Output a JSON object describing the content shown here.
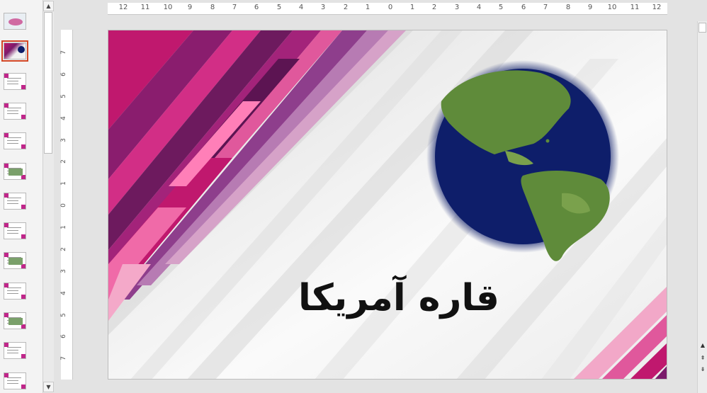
{
  "thumbnail_panel": {
    "selected_index": 1,
    "thumbs": [
      "slide-1",
      "slide-2",
      "slide-3",
      "slide-4",
      "slide-5",
      "slide-6",
      "slide-7",
      "slide-8",
      "slide-9",
      "slide-10",
      "slide-11",
      "slide-12",
      "slide-13"
    ]
  },
  "horizontal_ruler": {
    "labels": [
      "12",
      "11",
      "10",
      "9",
      "8",
      "7",
      "6",
      "5",
      "4",
      "3",
      "2",
      "1",
      "0",
      "1",
      "2",
      "3",
      "4",
      "5",
      "6",
      "7",
      "8",
      "9",
      "10",
      "11",
      "12"
    ]
  },
  "vertical_ruler": {
    "labels": [
      "7",
      "6",
      "5",
      "4",
      "3",
      "2",
      "1",
      "0",
      "1",
      "2",
      "3",
      "4",
      "5",
      "6",
      "7"
    ]
  },
  "slide": {
    "title": "قاره آمریکا",
    "accent_colors": [
      "#c0186e",
      "#7b1b6b",
      "#e0589c",
      "#f2a8c8"
    ],
    "ocean_color": "#0e1e6a",
    "land_color": "#5f8b3a"
  },
  "icons": {
    "scroll_up": "▲",
    "scroll_down": "▼",
    "prev_slide": "⇞",
    "next_slide": "⇟"
  }
}
